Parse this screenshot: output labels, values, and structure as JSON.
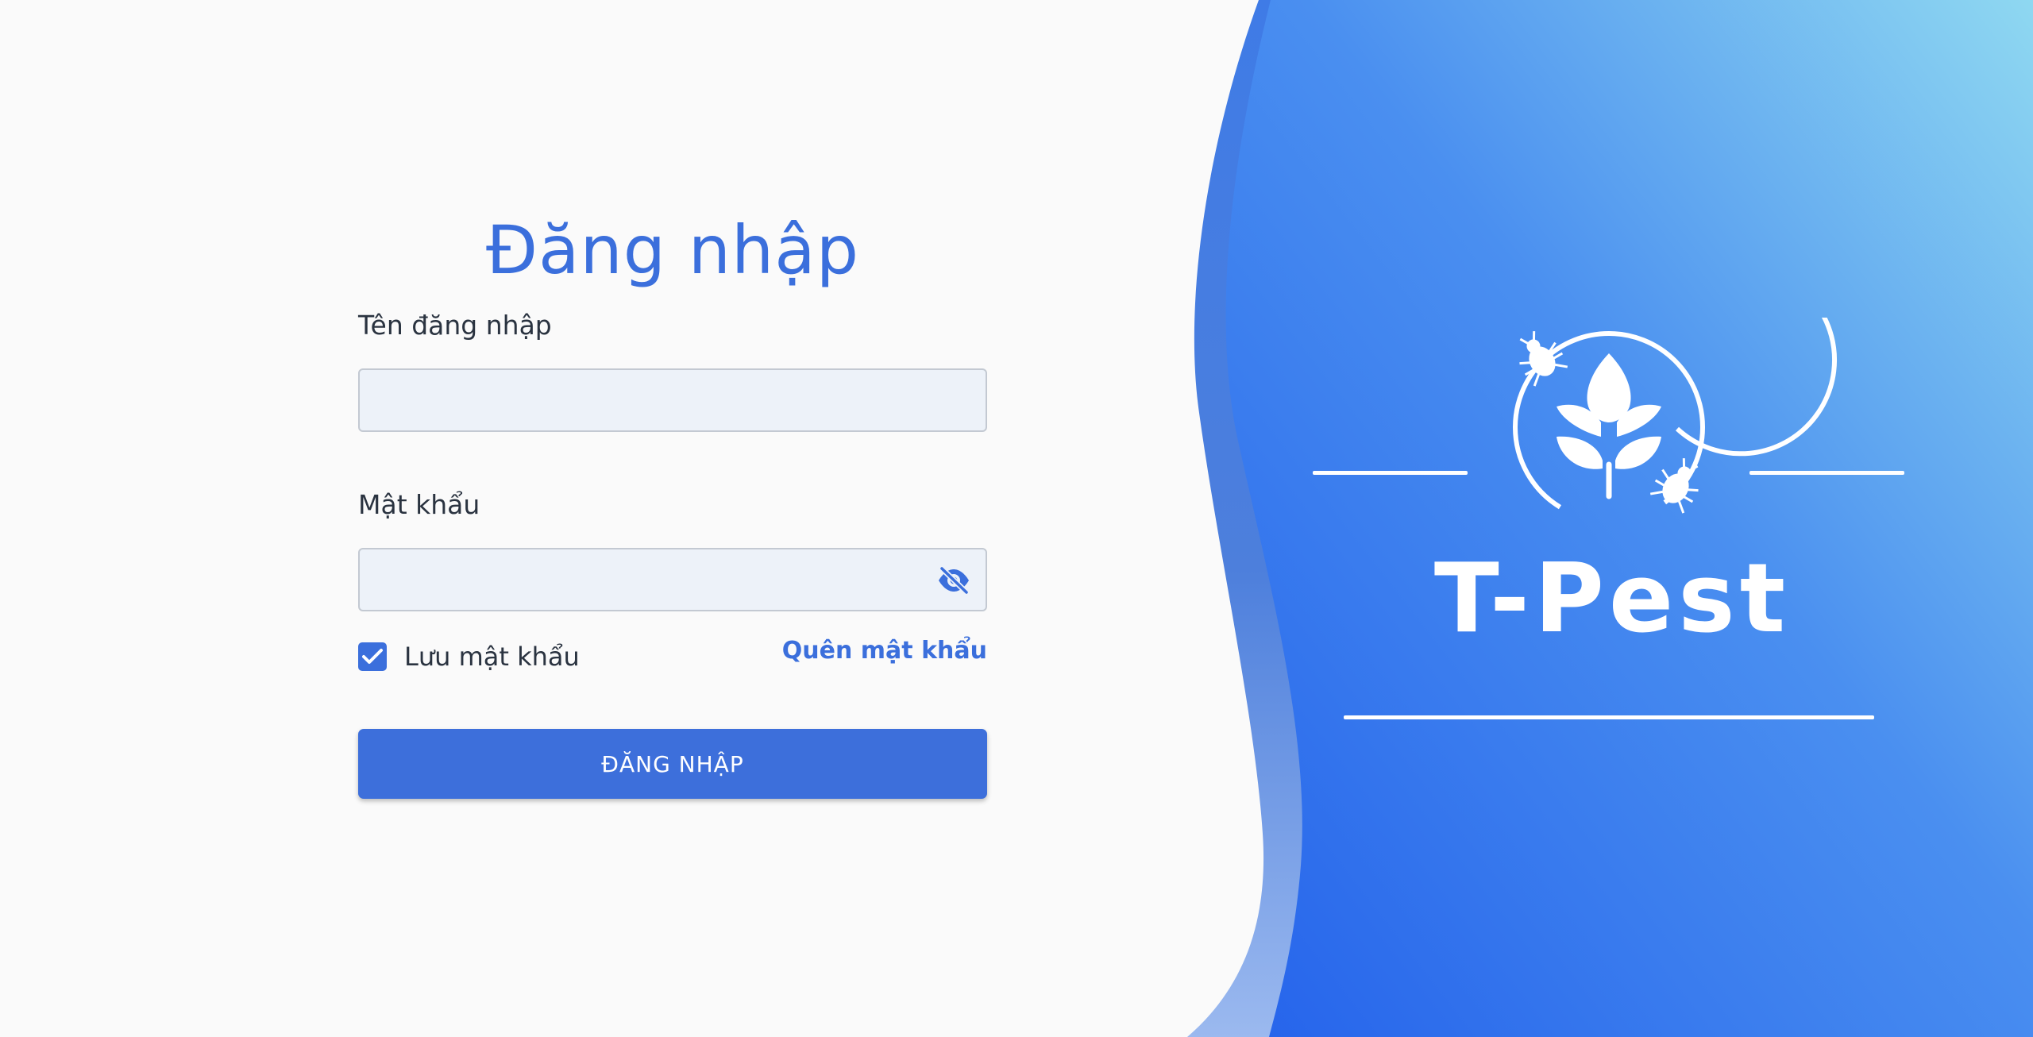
{
  "login": {
    "title": "Đăng nhập",
    "username_label": "Tên đăng nhập",
    "username_value": "",
    "password_label": "Mật khẩu",
    "password_value": "",
    "remember_label": "Lưu mật khẩu",
    "remember_checked": true,
    "forgot_link": "Quên mật khẩu",
    "submit_label": "ĐĂNG NHẬP"
  },
  "brand": {
    "name": "T-Pest",
    "logo_icon": "leaf-with-bugs-icon"
  },
  "colors": {
    "accent": "#3b6fdc",
    "panel_gradient_start": "#2563eb",
    "panel_gradient_end": "#8fd8f1",
    "input_bg": "#edf2f9",
    "page_bg": "#fafafa"
  }
}
